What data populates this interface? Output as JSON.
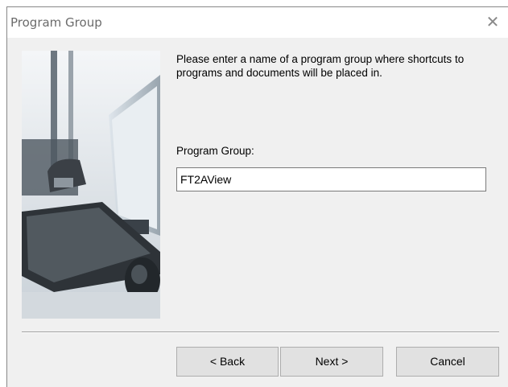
{
  "window": {
    "title": "Program Group",
    "close_glyph": "✕"
  },
  "content": {
    "prompt": "Please enter a name of a program group where shortcuts to programs and documents will be placed in.",
    "field_label": "Program Group:",
    "field_value": "FT2AView"
  },
  "buttons": {
    "back": "< Back",
    "next": "Next >",
    "cancel": "Cancel"
  },
  "image": {
    "subject": "office-desk-illustration"
  }
}
